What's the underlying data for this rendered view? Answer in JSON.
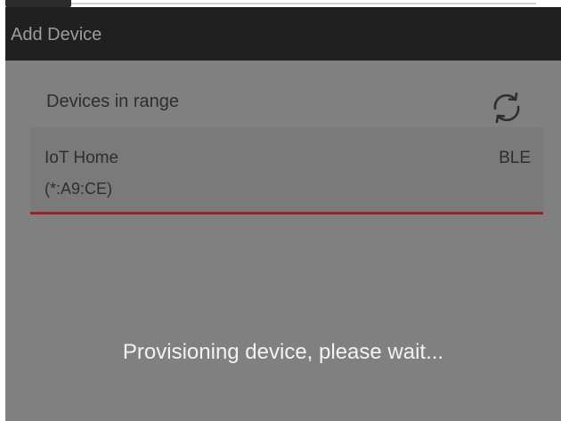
{
  "dialog": {
    "title": "Add Device"
  },
  "devices_section": {
    "label": "Devices in range",
    "refresh_icon": "refresh-icon"
  },
  "devices": [
    {
      "name": "IoT Home",
      "address": "(*:A9:CE)",
      "type": "BLE"
    }
  ],
  "status": {
    "message": "Provisioning device, please wait..."
  },
  "colors": {
    "titlebar": "#202020",
    "overlay": "#808080",
    "row_background": "#7a7a7a",
    "accent": "#8b2a2a",
    "status_text": "#f2f2f2"
  }
}
